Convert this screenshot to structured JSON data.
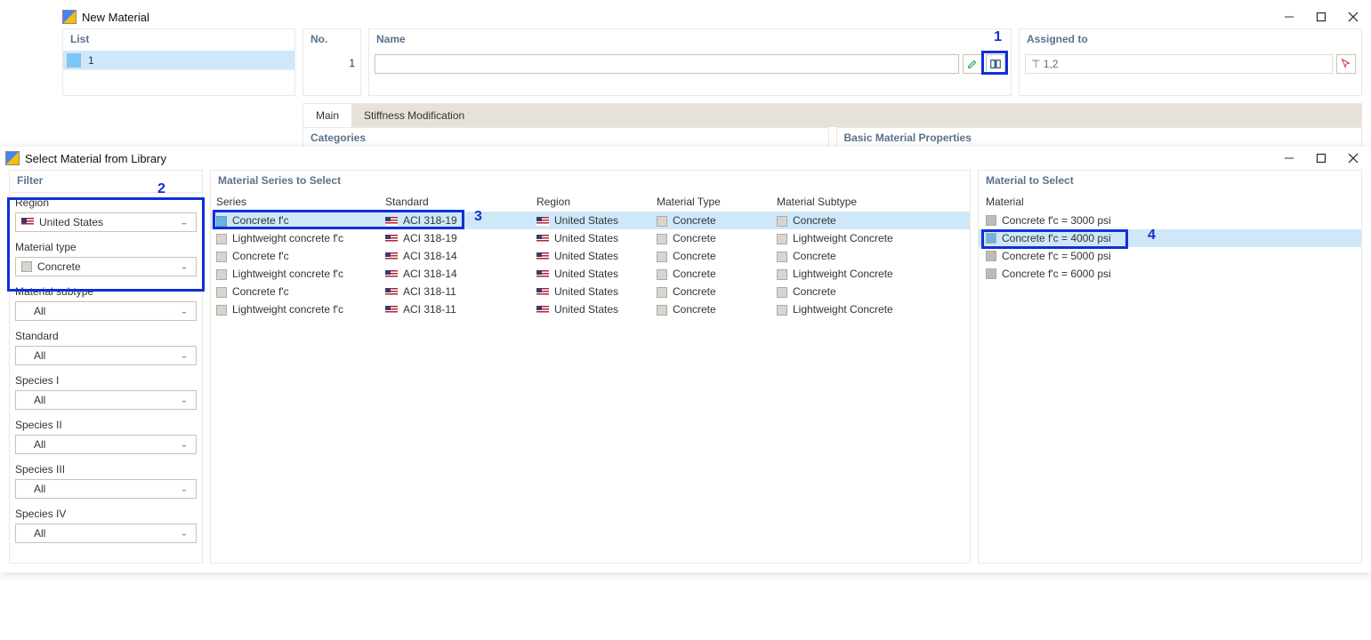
{
  "window1": {
    "title": "New Material",
    "list": {
      "header": "List",
      "items": [
        "1"
      ]
    },
    "no": {
      "header": "No.",
      "value": "1"
    },
    "name": {
      "header": "Name",
      "value": ""
    },
    "assigned": {
      "header": "Assigned to",
      "value": "⊤ 1,2"
    },
    "tabs": {
      "main": "Main",
      "stiff": "Stiffness Modification"
    },
    "panels": {
      "categories": "Categories",
      "props": "Basic Material Properties"
    },
    "annot1": "1"
  },
  "window2": {
    "title": "Select Material from Library",
    "annot2": "2",
    "annot3": "3",
    "annot4": "4",
    "filter": {
      "header": "Filter",
      "region": {
        "label": "Region",
        "value": "United States"
      },
      "material_type": {
        "label": "Material type",
        "value": "Concrete"
      },
      "subtype": {
        "label": "Material subtype",
        "value": "All"
      },
      "standard": {
        "label": "Standard",
        "value": "All"
      },
      "sp1": {
        "label": "Species I",
        "value": "All"
      },
      "sp2": {
        "label": "Species II",
        "value": "All"
      },
      "sp3": {
        "label": "Species III",
        "value": "All"
      },
      "sp4": {
        "label": "Species IV",
        "value": "All"
      }
    },
    "series": {
      "header": "Material Series to Select",
      "cols": {
        "series": "Series",
        "standard": "Standard",
        "region": "Region",
        "mtype": "Material Type",
        "msub": "Material Subtype"
      },
      "rows": [
        {
          "series": "Concrete f'c",
          "standard": "ACI 318-19",
          "region": "United States",
          "mtype": "Concrete",
          "msub": "Concrete",
          "selected": true
        },
        {
          "series": "Lightweight concrete f'c",
          "standard": "ACI 318-19",
          "region": "United States",
          "mtype": "Concrete",
          "msub": "Lightweight Concrete",
          "selected": false
        },
        {
          "series": "Concrete f'c",
          "standard": "ACI 318-14",
          "region": "United States",
          "mtype": "Concrete",
          "msub": "Concrete",
          "selected": false
        },
        {
          "series": "Lightweight concrete f'c",
          "standard": "ACI 318-14",
          "region": "United States",
          "mtype": "Concrete",
          "msub": "Lightweight Concrete",
          "selected": false
        },
        {
          "series": "Concrete f'c",
          "standard": "ACI 318-11",
          "region": "United States",
          "mtype": "Concrete",
          "msub": "Concrete",
          "selected": false
        },
        {
          "series": "Lightweight concrete f'c",
          "standard": "ACI 318-11",
          "region": "United States",
          "mtype": "Concrete",
          "msub": "Lightweight Concrete",
          "selected": false
        }
      ]
    },
    "materials": {
      "header": "Material to Select",
      "colhead": "Material",
      "rows": [
        {
          "name": "Concrete f'c = 3000 psi",
          "selected": false
        },
        {
          "name": "Concrete f'c = 4000 psi",
          "selected": true
        },
        {
          "name": "Concrete f'c = 5000 psi",
          "selected": false
        },
        {
          "name": "Concrete f'c = 6000 psi",
          "selected": false
        }
      ]
    }
  }
}
